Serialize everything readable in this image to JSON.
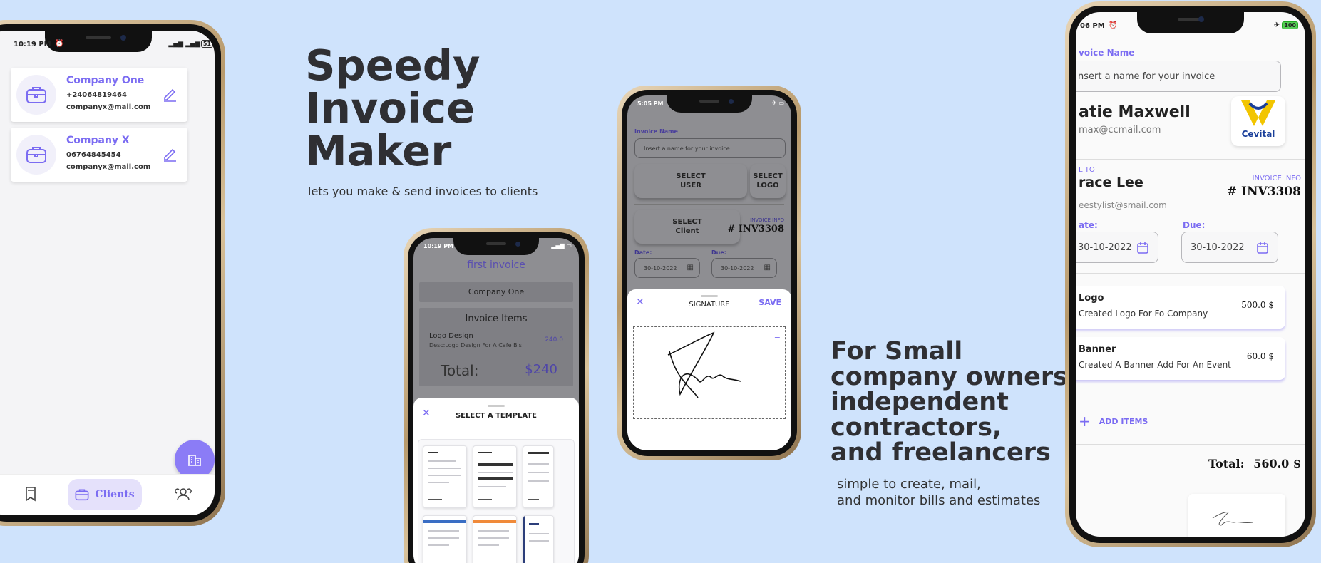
{
  "marketing": {
    "title_line1": "Speedy",
    "title_line2": "Invoice",
    "title_line3": "Maker",
    "subtitle": "lets you make & send invoices to clients",
    "audience_line1": "For Small",
    "audience_line2": "company owners,",
    "audience_line3": "independent",
    "audience_line4": "contractors,",
    "audience_line5": "and freelancers",
    "audience_sub1": "simple to create, mail,",
    "audience_sub2": "and monitor bills and estimates"
  },
  "phone_clients": {
    "status_time": "10:19 PM",
    "battery": "51",
    "clients": [
      {
        "name": "Company One",
        "phone": "+24064819464",
        "email": "companyx@mail.com"
      },
      {
        "name": "Company X",
        "phone": "06764845454",
        "email": "companyx@mail.com"
      }
    ],
    "nav_active_label": "Clients"
  },
  "phone_template": {
    "status_time": "10:19 PM",
    "invoice_title": "first invoice",
    "company": "Company One",
    "items_heading": "Invoice Items",
    "item_name": "Logo Design",
    "item_desc": "Desc:Logo Design For A Cafe Bis",
    "item_price": "240.0",
    "total_label": "Total:",
    "total_value": "$240",
    "sheet_title": "SELECT A TEMPLATE"
  },
  "phone_signature": {
    "status_time": "5:05 PM",
    "invoice_name_label": "Invoice Name",
    "invoice_name_placeholder": "Insert a name for your invoice",
    "select_user": "SELECT\nUSER",
    "select_logo": "SELECT\nLOGO",
    "select_client": "SELECT\nClient",
    "invoice_info_label": "INVOICE INFO",
    "invoice_number": "# INV3308",
    "date_label": "Date:",
    "due_label": "Due:",
    "date_value": "30-10-2022",
    "due_value": "30-10-2022",
    "sheet_title": "SIGNATURE",
    "save_label": "SAVE"
  },
  "phone_invoice": {
    "status_time": "06 PM",
    "battery": "100",
    "invoice_name_label": "voice Name",
    "invoice_name_placeholder": "nsert a name for your invoice",
    "user_name": "atie Maxwell",
    "user_email": "max@ccmail.com",
    "logo_text": "Cevital",
    "bill_to_label": "L TO",
    "client_name": "race Lee",
    "client_email": "eestylist@smail.com",
    "invoice_info_label": "INVOICE INFO",
    "invoice_number": "# INV3308",
    "date_label": "ate:",
    "due_label": "Due:",
    "date_value": "30-10-2022",
    "due_value": "30-10-2022",
    "items": [
      {
        "name": "Logo",
        "desc": "Created Logo For Fo Company",
        "price": "500.0 $"
      },
      {
        "name": "Banner",
        "desc": "Created A Banner Add For An Event",
        "price": "60.0 $"
      }
    ],
    "add_items_label": "ADD ITEMS",
    "total_label": "Total:",
    "total_value": "560.0 $"
  },
  "colors": {
    "background": "#cfe3fc",
    "accent": "#7b6cf2",
    "text": "#2f2f33"
  }
}
